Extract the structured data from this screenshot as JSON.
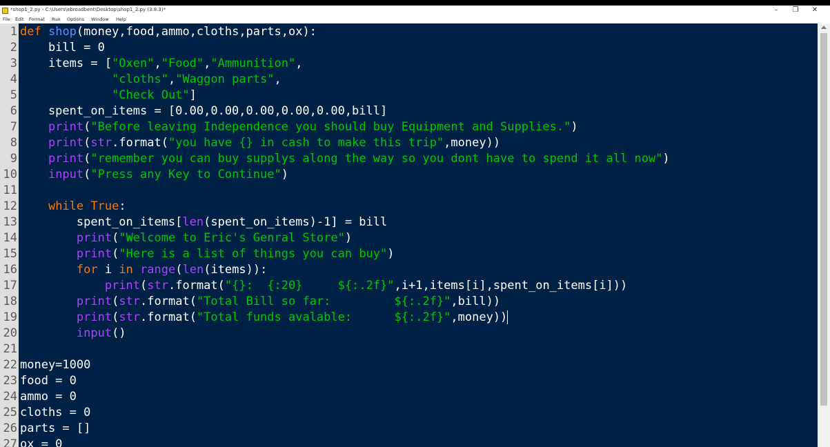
{
  "window": {
    "title": "*shop1_2.py - C:\\Users\\ebroadbent\\Desktop\\shop1_2.py (3.8.3)*",
    "minimize": "–",
    "maximize": "❐",
    "close": "✕"
  },
  "menu": [
    "File",
    "Edit",
    "Format",
    "Run",
    "Options",
    "Window",
    "Help"
  ],
  "editor": {
    "lines": [
      {
        "n": "1",
        "t": [
          [
            "kw",
            "def"
          ],
          [
            "p",
            " "
          ],
          [
            "fn",
            "shop"
          ],
          [
            "p",
            "(money,food,ammo,cloths,parts,ox):"
          ]
        ]
      },
      {
        "n": "2",
        "t": [
          [
            "p",
            "    bill = 0"
          ]
        ]
      },
      {
        "n": "3",
        "t": [
          [
            "p",
            "    items = ["
          ],
          [
            "st",
            "\"Oxen\""
          ],
          [
            "p",
            ","
          ],
          [
            "st",
            "\"Food\""
          ],
          [
            "p",
            ","
          ],
          [
            "st",
            "\"Ammunition\""
          ],
          [
            "p",
            ","
          ]
        ]
      },
      {
        "n": "4",
        "t": [
          [
            "p",
            "             "
          ],
          [
            "st",
            "\"cloths\""
          ],
          [
            "p",
            ","
          ],
          [
            "st",
            "\"Waggon parts\""
          ],
          [
            "p",
            ","
          ]
        ]
      },
      {
        "n": "5",
        "t": [
          [
            "p",
            "             "
          ],
          [
            "st",
            "\"Check Out\""
          ],
          [
            "p",
            "]"
          ]
        ]
      },
      {
        "n": "6",
        "t": [
          [
            "p",
            "    spent_on_items = [0.00,0.00,0.00,0.00,0.00,bill]"
          ]
        ]
      },
      {
        "n": "7",
        "t": [
          [
            "p",
            "    "
          ],
          [
            "bi",
            "print"
          ],
          [
            "p",
            "("
          ],
          [
            "st",
            "\"Before leaving Independence you should buy Equipment and Supplies.\""
          ],
          [
            "p",
            ")"
          ]
        ]
      },
      {
        "n": "8",
        "t": [
          [
            "p",
            "    "
          ],
          [
            "bi",
            "print"
          ],
          [
            "p",
            "("
          ],
          [
            "bi",
            "str"
          ],
          [
            "p",
            ".format("
          ],
          [
            "st",
            "\"you have {} in cash to make this trip\""
          ],
          [
            "p",
            ",money))"
          ]
        ]
      },
      {
        "n": "9",
        "t": [
          [
            "p",
            "    "
          ],
          [
            "bi",
            "print"
          ],
          [
            "p",
            "("
          ],
          [
            "st",
            "\"remember you can buy supplys along the way so you dont have to spend it all now\""
          ],
          [
            "p",
            ")"
          ]
        ]
      },
      {
        "n": "10",
        "t": [
          [
            "p",
            "    "
          ],
          [
            "bi",
            "input"
          ],
          [
            "p",
            "("
          ],
          [
            "st",
            "\"Press any Key to Continue\""
          ],
          [
            "p",
            ")"
          ]
        ]
      },
      {
        "n": "11",
        "t": []
      },
      {
        "n": "12",
        "t": [
          [
            "p",
            "    "
          ],
          [
            "kw",
            "while"
          ],
          [
            "p",
            " "
          ],
          [
            "kw",
            "True"
          ],
          [
            "p",
            ":"
          ]
        ]
      },
      {
        "n": "13",
        "t": [
          [
            "p",
            "        spent_on_items["
          ],
          [
            "bi",
            "len"
          ],
          [
            "p",
            "(spent_on_items)-1] = bill"
          ]
        ]
      },
      {
        "n": "14",
        "t": [
          [
            "p",
            "        "
          ],
          [
            "bi",
            "print"
          ],
          [
            "p",
            "("
          ],
          [
            "st",
            "\"Welcome to Eric's Genral Store\""
          ],
          [
            "p",
            ")"
          ]
        ]
      },
      {
        "n": "15",
        "t": [
          [
            "p",
            "        "
          ],
          [
            "bi",
            "print"
          ],
          [
            "p",
            "("
          ],
          [
            "st",
            "\"Here is a list of things you can buy\""
          ],
          [
            "p",
            ")"
          ]
        ]
      },
      {
        "n": "16",
        "t": [
          [
            "p",
            "        "
          ],
          [
            "kw",
            "for"
          ],
          [
            "p",
            " i "
          ],
          [
            "kw",
            "in"
          ],
          [
            "p",
            " "
          ],
          [
            "bi",
            "range"
          ],
          [
            "p",
            "("
          ],
          [
            "bi",
            "len"
          ],
          [
            "p",
            "(items)):"
          ]
        ]
      },
      {
        "n": "17",
        "t": [
          [
            "p",
            "            "
          ],
          [
            "bi",
            "print"
          ],
          [
            "p",
            "("
          ],
          [
            "bi",
            "str"
          ],
          [
            "p",
            ".format("
          ],
          [
            "st",
            "\"{}:  {:20}     ${:.2f}\""
          ],
          [
            "p",
            ",i+1,items[i],spent_on_items[i]))"
          ]
        ]
      },
      {
        "n": "18",
        "t": [
          [
            "p",
            "        "
          ],
          [
            "bi",
            "print"
          ],
          [
            "p",
            "("
          ],
          [
            "bi",
            "str"
          ],
          [
            "p",
            ".format("
          ],
          [
            "st",
            "\"Total Bill so far:         ${:.2f}\""
          ],
          [
            "p",
            ",bill))"
          ]
        ]
      },
      {
        "n": "19",
        "t": [
          [
            "p",
            "        "
          ],
          [
            "bi",
            "print"
          ],
          [
            "p",
            "("
          ],
          [
            "bi",
            "str"
          ],
          [
            "p",
            ".format("
          ],
          [
            "st",
            "\"Total funds avalable:      ${:.2f}\""
          ],
          [
            "p",
            ",money))"
          ]
        ]
      },
      {
        "n": "20",
        "t": [
          [
            "p",
            "        "
          ],
          [
            "bi",
            "input"
          ],
          [
            "p",
            "()"
          ]
        ]
      },
      {
        "n": "21",
        "t": []
      },
      {
        "n": "22",
        "t": [
          [
            "p",
            "money=1000"
          ]
        ]
      },
      {
        "n": "23",
        "t": [
          [
            "p",
            "food = 0"
          ]
        ]
      },
      {
        "n": "24",
        "t": [
          [
            "p",
            "ammo = 0"
          ]
        ]
      },
      {
        "n": "25",
        "t": [
          [
            "p",
            "cloths = 0"
          ]
        ]
      },
      {
        "n": "26",
        "t": [
          [
            "p",
            "parts = []"
          ]
        ]
      },
      {
        "n": "27",
        "t": [
          [
            "p",
            "ox = 0"
          ]
        ]
      }
    ],
    "colors": {
      "background": "#002146",
      "keyword": "#ff7700",
      "builtin": "#b040ff",
      "definition": "#5b8fff",
      "string": "#00c800",
      "text": "#ffffff"
    }
  }
}
